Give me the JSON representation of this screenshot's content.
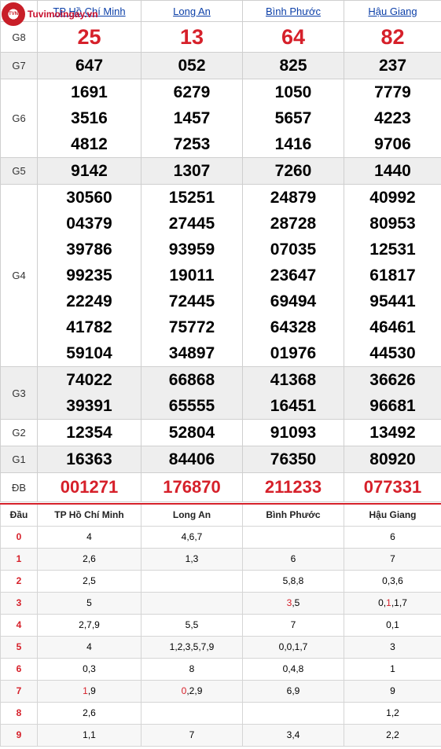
{
  "logo_text": "Tuvimoingay.vn",
  "logo_badge": "TVN",
  "provinces": [
    "TP Hồ Chí Minh",
    "Long An",
    "Bình Phước",
    "Hậu Giang"
  ],
  "prizes": [
    {
      "label": "G8",
      "kind": "big",
      "values": [
        [
          "25"
        ],
        [
          "13"
        ],
        [
          "64"
        ],
        [
          "82"
        ]
      ]
    },
    {
      "label": "G7",
      "kind": "num",
      "values": [
        [
          "647"
        ],
        [
          "052"
        ],
        [
          "825"
        ],
        [
          "237"
        ]
      ]
    },
    {
      "label": "G6",
      "kind": "num",
      "values": [
        [
          "1691",
          "3516",
          "4812"
        ],
        [
          "6279",
          "1457",
          "7253"
        ],
        [
          "1050",
          "5657",
          "1416"
        ],
        [
          "7779",
          "4223",
          "9706"
        ]
      ]
    },
    {
      "label": "G5",
      "kind": "num",
      "values": [
        [
          "9142"
        ],
        [
          "1307"
        ],
        [
          "7260"
        ],
        [
          "1440"
        ]
      ]
    },
    {
      "label": "G4",
      "kind": "num",
      "values": [
        [
          "30560",
          "04379",
          "39786",
          "99235",
          "22249",
          "41782",
          "59104"
        ],
        [
          "15251",
          "27445",
          "93959",
          "19011",
          "72445",
          "75772",
          "34897"
        ],
        [
          "24879",
          "28728",
          "07035",
          "23647",
          "69494",
          "64328",
          "01976"
        ],
        [
          "40992",
          "80953",
          "12531",
          "61817",
          "95441",
          "46461",
          "44530"
        ]
      ]
    },
    {
      "label": "G3",
      "kind": "num",
      "values": [
        [
          "74022",
          "39391"
        ],
        [
          "66868",
          "65555"
        ],
        [
          "41368",
          "16451"
        ],
        [
          "36626",
          "96681"
        ]
      ]
    },
    {
      "label": "G2",
      "kind": "num",
      "values": [
        [
          "12354"
        ],
        [
          "52804"
        ],
        [
          "91093"
        ],
        [
          "13492"
        ]
      ]
    },
    {
      "label": "G1",
      "kind": "num",
      "values": [
        [
          "16363"
        ],
        [
          "84406"
        ],
        [
          "76350"
        ],
        [
          "80920"
        ]
      ]
    },
    {
      "label": "ĐB",
      "kind": "spec",
      "values": [
        [
          "001271"
        ],
        [
          "176870"
        ],
        [
          "211233"
        ],
        [
          "077331"
        ]
      ]
    }
  ],
  "heads_header": "Đầu",
  "heads": [
    {
      "k": "0",
      "v": [
        "4",
        "4,6,7",
        "",
        "6"
      ]
    },
    {
      "k": "1",
      "v": [
        "2,6",
        "1,3",
        "6",
        "7"
      ]
    },
    {
      "k": "2",
      "v": [
        "2,5",
        "",
        "5,8,8",
        "0,3,6"
      ]
    },
    {
      "k": "3",
      "v": [
        "5",
        "",
        "3,5",
        "0,1,1,7"
      ],
      "hl": [
        [],
        [],
        [
          0
        ],
        [
          1
        ]
      ]
    },
    {
      "k": "4",
      "v": [
        "2,7,9",
        "5,5",
        "7",
        "0,1"
      ]
    },
    {
      "k": "5",
      "v": [
        "4",
        "1,2,3,5,7,9",
        "0,0,1,7",
        "3"
      ]
    },
    {
      "k": "6",
      "v": [
        "0,3",
        "8",
        "0,4,8",
        "1"
      ]
    },
    {
      "k": "7",
      "v": [
        "1,9",
        "0,2,9",
        "6,9",
        "9"
      ],
      "hl": [
        [
          0
        ],
        [
          0
        ],
        [],
        []
      ]
    },
    {
      "k": "8",
      "v": [
        "2,6",
        "",
        "",
        "1,2"
      ]
    },
    {
      "k": "9",
      "v": [
        "1,1",
        "7",
        "3,4",
        "2,2"
      ]
    }
  ],
  "colors": {
    "accent_red": "#d6202a",
    "link_blue": "#0b3fa8",
    "shade": "#eeeeee"
  }
}
